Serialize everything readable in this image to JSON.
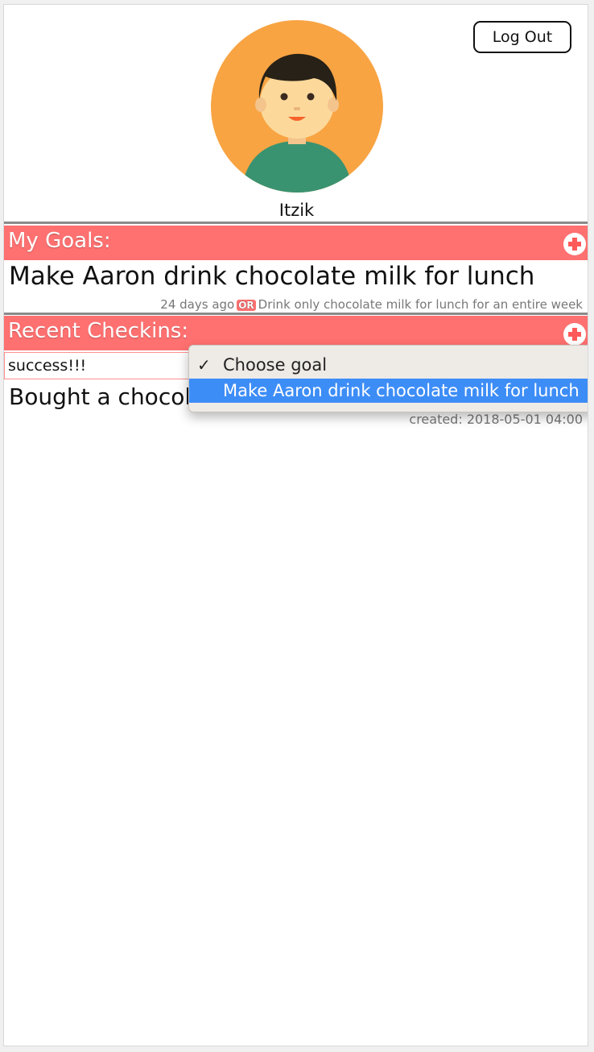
{
  "header": {
    "logout_label": "Log Out",
    "username": "Itzik",
    "avatar_icon": "user-avatar-icon"
  },
  "goals": {
    "title": "My Goals:",
    "add_icon": "plus-circle-icon",
    "items": [
      {
        "title": "Make Aaron drink chocolate milk for lunch",
        "age": "24 days ago",
        "or_label": "OR",
        "alternative": "Drink only chocolate milk for lunch for an entire week"
      }
    ]
  },
  "checkins": {
    "title": "Recent Checkins:",
    "add_icon": "plus-circle-icon",
    "input_value": "success!!!",
    "items": [
      {
        "text": "Bought a chocol",
        "created": "created: 2018-05-01 04:00"
      }
    ]
  },
  "goal_select": {
    "options": [
      {
        "label": "Choose goal",
        "checked": true,
        "check_glyph": "✓"
      },
      {
        "label": "Make Aaron drink chocolate milk for lunch",
        "highlighted": true
      }
    ]
  },
  "colors": {
    "accent": "#ff7070",
    "highlight": "#3d8df7",
    "avatar_bg": "#f8a443",
    "avatar_shirt": "#3a9370"
  }
}
